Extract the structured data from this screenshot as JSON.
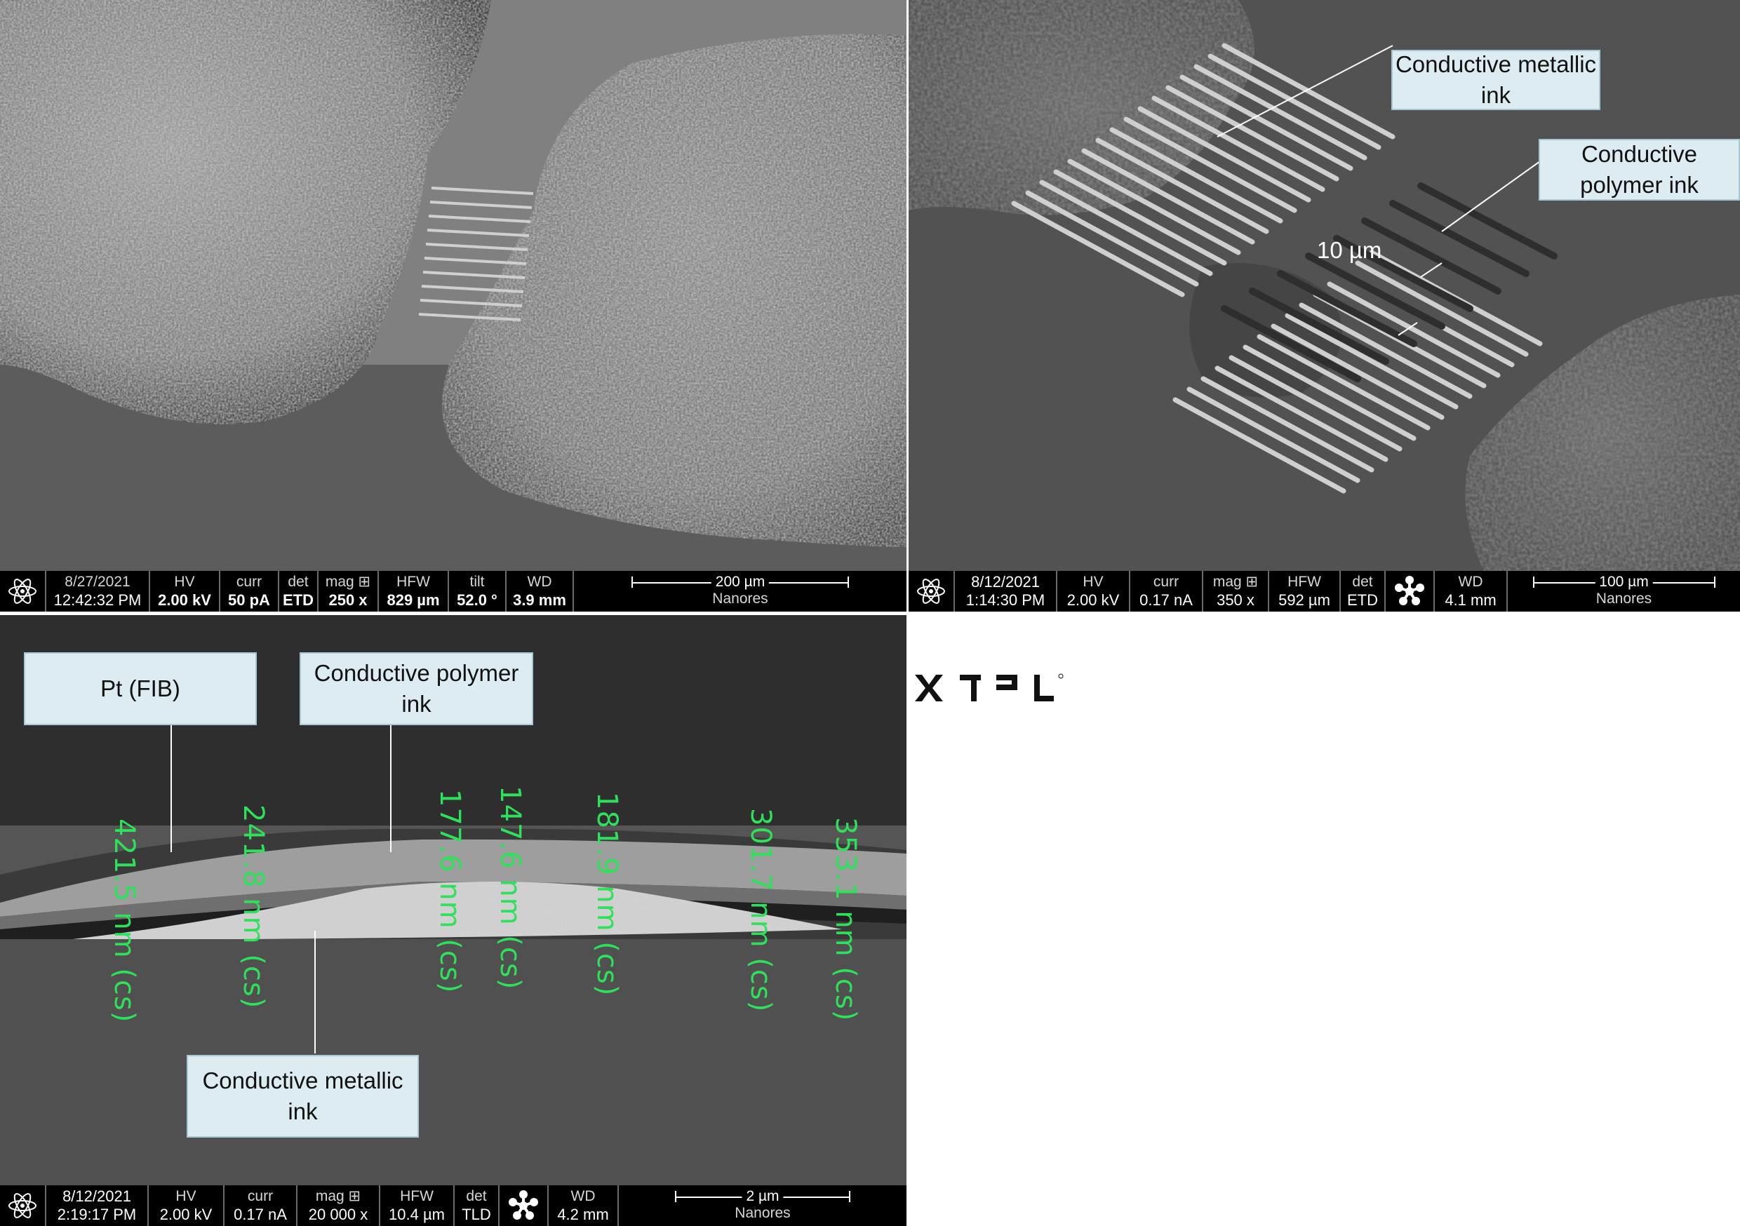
{
  "panel_top_left": {
    "databar": {
      "date": "8/27/2021",
      "time": "12:42:32 PM",
      "hv_label": "HV",
      "hv": "2.00 kV",
      "curr_label": "curr",
      "curr": "50 pA",
      "det_label": "det",
      "det": "ETD",
      "mag_label": "mag ⊞",
      "mag": "250 x",
      "hfw_label": "HFW",
      "hfw": "829 µm",
      "tilt_label": "tilt",
      "tilt": "52.0 °",
      "wd_label": "WD",
      "wd": "3.9 mm",
      "scale": "200 µm",
      "brand": "Nanores"
    }
  },
  "panel_top_right": {
    "callouts": {
      "metallic": "Conductive metallic ink",
      "polymer": "Conductive polymer ink"
    },
    "gap_label": "10 µm",
    "databar": {
      "date": "8/12/2021",
      "time": "1:14:30 PM",
      "hv_label": "HV",
      "hv": "2.00 kV",
      "curr_label": "curr",
      "curr": "0.17 nA",
      "mag_label": "mag ⊞",
      "mag": "350 x",
      "hfw_label": "HFW",
      "hfw": "592 µm",
      "det_label": "det",
      "det": "ETD",
      "wd_label": "WD",
      "wd": "4.1 mm",
      "scale": "100 µm",
      "brand": "Nanores"
    }
  },
  "panel_bottom_left": {
    "callouts": {
      "pt": "Pt (FIB)",
      "polymer": "Conductive polymer ink",
      "metallic": "Conductive metallic ink"
    },
    "measurements": [
      "421.5 nm (cs)",
      "241.8 nm (cs)",
      "177.6 nm (cs)",
      "147.6 nm (cs)",
      "181.9 nm (cs)",
      "301.7 nm (cs)",
      "353.1 nm (cs)"
    ],
    "databar": {
      "date": "8/12/2021",
      "time": "2:19:17 PM",
      "hv_label": "HV",
      "hv": "2.00 kV",
      "curr_label": "curr",
      "curr": "0.17 nA",
      "mag_label": "mag ⊞",
      "mag": "20 000 x",
      "hfw_label": "HFW",
      "hfw": "10.4 µm",
      "det_label": "det",
      "det": "TLD",
      "wd_label": "WD",
      "wd": "4.2 mm",
      "scale": "2 µm",
      "brand": "Nanores"
    }
  },
  "logo": {
    "text": "XTPL",
    "mark": "®"
  }
}
